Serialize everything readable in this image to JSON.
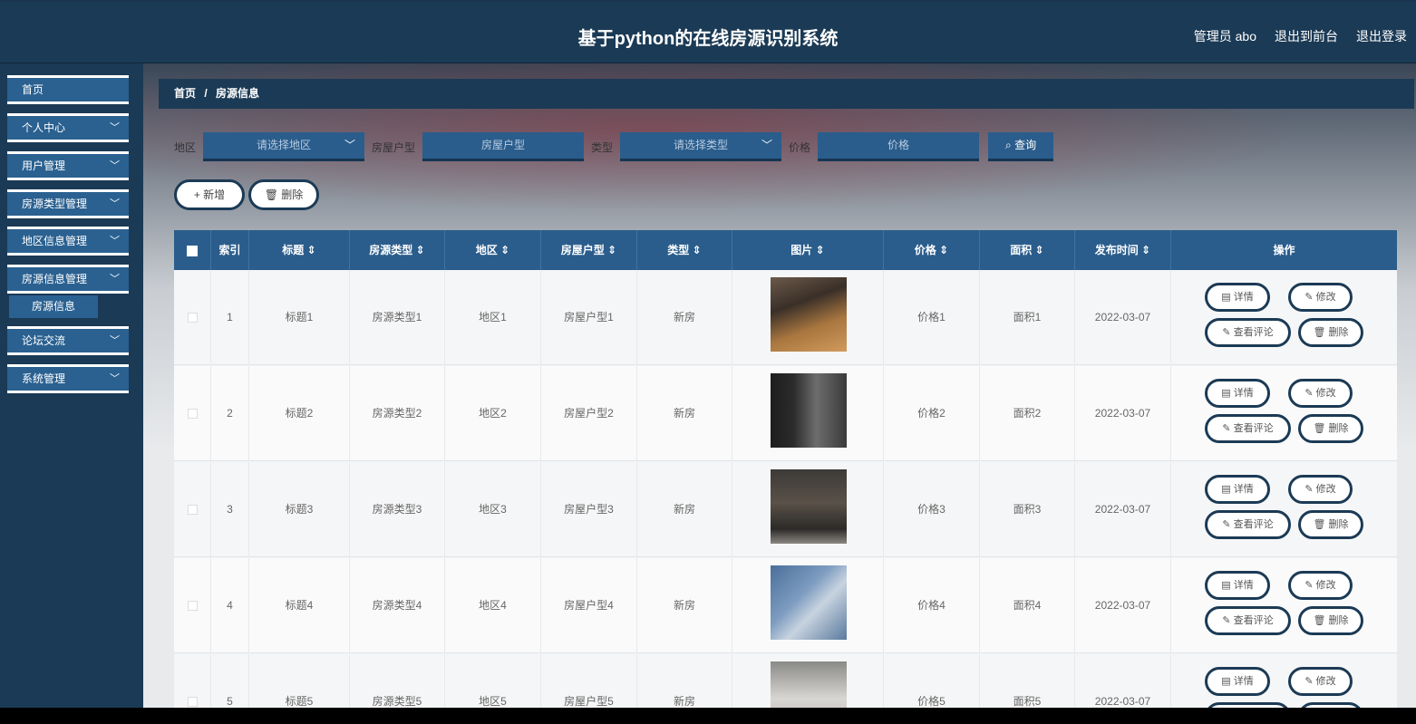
{
  "header": {
    "title": "基于python的在线房源识别系统",
    "admin_label": "管理员 abo",
    "back_front": "退出到前台",
    "logout": "退出登录"
  },
  "sidebar": {
    "items": [
      {
        "label": "首页"
      },
      {
        "label": "个人中心"
      },
      {
        "label": "用户管理"
      },
      {
        "label": "房源类型管理"
      },
      {
        "label": "地区信息管理"
      },
      {
        "label": "房源信息管理"
      },
      {
        "label": "论坛交流"
      },
      {
        "label": "系统管理"
      }
    ],
    "sub_item": "房源信息",
    "chevron": "chevron-down-icon"
  },
  "breadcrumb": {
    "home": "首页",
    "sep": "/",
    "current": "房源信息"
  },
  "filters": {
    "region_label": "地区",
    "region_placeholder": "请选择地区",
    "layout_label": "房屋户型",
    "layout_placeholder": "房屋户型",
    "type_label": "类型",
    "type_placeholder": "请选择类型",
    "price_label": "价格",
    "price_placeholder": "价格",
    "search_label": "查询"
  },
  "actions": {
    "add": "+ 新增",
    "delete": "删除"
  },
  "table": {
    "headers": {
      "index": "索引",
      "title": "标题",
      "house_type": "房源类型",
      "region": "地区",
      "layout": "房屋户型",
      "type": "类型",
      "image": "图片",
      "price": "价格",
      "area": "面积",
      "publish_time": "发布时间",
      "ops": "操作"
    },
    "sort_icon": "sort-icon",
    "op_labels": {
      "detail": "详情",
      "edit": "修改",
      "comments": "查看评论",
      "delete": "删除"
    },
    "rows": [
      {
        "index": "1",
        "title": "标题1",
        "house_type": "房源类型1",
        "region": "地区1",
        "layout": "房屋户型1",
        "type": "新房",
        "price": "价格1",
        "area": "面积1",
        "time": "2022-03-07"
      },
      {
        "index": "2",
        "title": "标题2",
        "house_type": "房源类型2",
        "region": "地区2",
        "layout": "房屋户型2",
        "type": "新房",
        "price": "价格2",
        "area": "面积2",
        "time": "2022-03-07"
      },
      {
        "index": "3",
        "title": "标题3",
        "house_type": "房源类型3",
        "region": "地区3",
        "layout": "房屋户型3",
        "type": "新房",
        "price": "价格3",
        "area": "面积3",
        "time": "2022-03-07"
      },
      {
        "index": "4",
        "title": "标题4",
        "house_type": "房源类型4",
        "region": "地区4",
        "layout": "房屋户型4",
        "type": "新房",
        "price": "价格4",
        "area": "面积4",
        "time": "2022-03-07"
      },
      {
        "index": "5",
        "title": "标题5",
        "house_type": "房源类型5",
        "region": "地区5",
        "layout": "房屋户型5",
        "type": "新房",
        "price": "价格5",
        "area": "面积5",
        "time": "2022-03-07"
      }
    ]
  },
  "colors": {
    "primary": "#2a5d8c",
    "dark": "#1b3a55"
  }
}
